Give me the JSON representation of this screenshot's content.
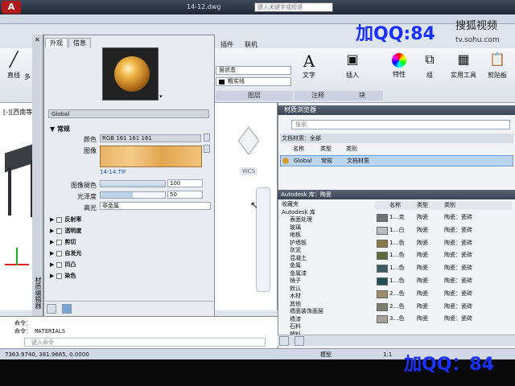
{
  "title": {
    "doc": "14-12.dwg",
    "search_placeholder": "键入关键字或短语"
  },
  "watermark": {
    "top": "加QQ:84",
    "site_cn": "搜狐视频",
    "site_url": "tv.sohu.com",
    "bottom": "加QQ：84"
  },
  "ribbon": {
    "tabs": [
      "插件",
      "联机"
    ],
    "draw": {
      "line": "直线",
      "multi": "多"
    },
    "layer_state": "层状态",
    "layer_name": "粗实线",
    "layers_label": "图层",
    "text": "文字",
    "annotate_label": "注释",
    "insert": "插入",
    "block_label": "块",
    "properties": "特性",
    "group": "组",
    "utilities": "实用工具",
    "clipboard": "剪贴板"
  },
  "viewport": {
    "label": "[-][西南等",
    "wcs": "WCS"
  },
  "material_editor": {
    "side_title": "材质编辑器",
    "tabs": [
      "外观",
      "信息"
    ],
    "material_name": "Global",
    "section_general": "常规",
    "color_label": "颜色",
    "color_value": "RGB 161 161 161",
    "image_label": "图像",
    "image_file": "14-14.TIF",
    "fade_label": "图像褪色",
    "fade_value": "100",
    "gloss_label": "光泽度",
    "gloss_value": "50",
    "highlight_label": "高光",
    "highlight_value": "非金属",
    "sections": [
      "反射率",
      "透明度",
      "剪切",
      "自发光",
      "凹凸",
      "染色"
    ]
  },
  "browser": {
    "title": "材质浏览器",
    "search": "搜索",
    "doc_materials": "文档材质：全部",
    "columns": [
      "名称",
      "类型",
      "类别"
    ],
    "doc_row": {
      "name": "Global",
      "type": "常规",
      "category": "文档材质"
    },
    "library_title": "Autodesk 库：陶瓷",
    "tree": [
      "收藏夹",
      "Autodesk 库",
      "表面处理",
      "玻璃",
      "地板",
      "护墙板",
      "灰泥",
      "混凝土",
      "金属",
      "金属漆",
      "镜子",
      "默认",
      "木材",
      "其他",
      "墙面装饰面层",
      "墙漆",
      "石料",
      "塑料"
    ],
    "lib_columns": [
      "名称",
      "类型",
      "类别"
    ],
    "lib_rows": [
      {
        "name": "1…克",
        "type": "陶瓷",
        "category": "陶瓷：瓷砖",
        "color": "#6f7278"
      },
      {
        "name": "1…白",
        "type": "陶瓷",
        "category": "陶瓷：瓷砖",
        "color": "#b9bec2"
      },
      {
        "name": "1…色",
        "type": "陶瓷",
        "category": "陶瓷：瓷砖",
        "color": "#8a7a4a"
      },
      {
        "name": "1…色",
        "type": "陶瓷",
        "category": "陶瓷：瓷砖",
        "color": "#5e6a3a"
      },
      {
        "name": "1…色",
        "type": "陶瓷",
        "category": "陶瓷：瓷砖",
        "color": "#3b5c62"
      },
      {
        "name": "1…色",
        "type": "陶瓷",
        "category": "陶瓷：瓷砖",
        "color": "#1f4f56"
      },
      {
        "name": "2…色",
        "type": "陶瓷",
        "category": "陶瓷：瓷砖",
        "color": "#9c8c6a"
      },
      {
        "name": "2…色",
        "type": "陶瓷",
        "category": "陶瓷：瓷砖",
        "color": "#7d7a6e"
      },
      {
        "name": "3…色",
        "type": "陶瓷",
        "category": "陶瓷：瓷砖",
        "color": "#a6a298"
      }
    ]
  },
  "command": {
    "line1": "命令：",
    "line2": "命令： MATERIALS",
    "prompt": "键入命令"
  },
  "status": {
    "coords": "7363.9740, 381.9685, 0.0000",
    "model": "模型",
    "scale": "1:1"
  }
}
